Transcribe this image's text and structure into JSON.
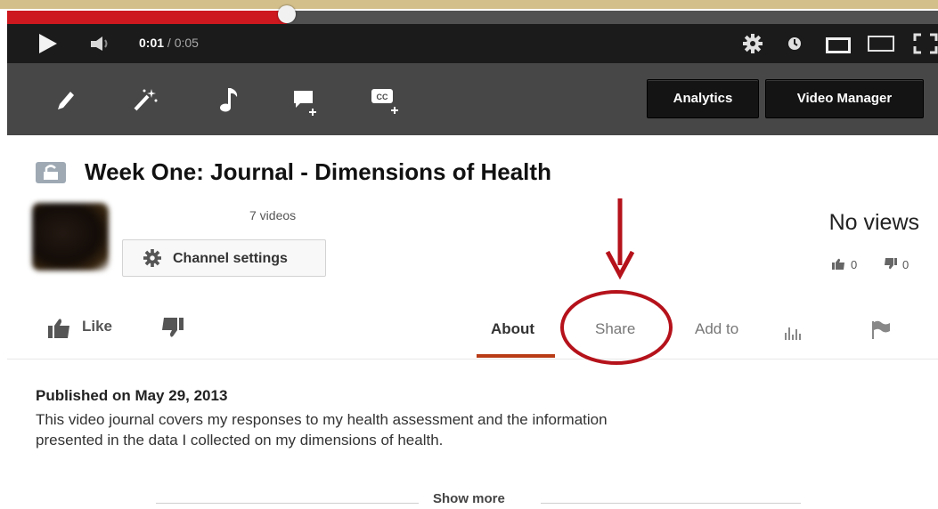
{
  "player": {
    "progress_fraction": 0.3,
    "time_current": "0:01",
    "time_separator": " / ",
    "time_total": "0:05",
    "icons": [
      "play-icon",
      "volume-icon",
      "settings-gear-icon",
      "watch-later-icon",
      "small-player-icon",
      "large-player-icon",
      "fullscreen-icon"
    ]
  },
  "toolbar": {
    "tool_icons": [
      "pencil-edit-icon",
      "magic-wand-enhance-icon",
      "music-note-audio-icon",
      "annotations-icon",
      "captions-cc-icon"
    ],
    "analytics_label": "Analytics",
    "video_manager_label": "Video Manager"
  },
  "video": {
    "title": "Week One: Journal - Dimensions of Health",
    "privacy_icon": "lock-icon"
  },
  "channel": {
    "video_count": "7 videos",
    "settings_label": "Channel settings"
  },
  "stats": {
    "views": "No views",
    "likes": "0",
    "dislikes": "0"
  },
  "actions": {
    "like_label": "Like",
    "tabs": [
      {
        "label": "About",
        "active": true
      },
      {
        "label": "Share",
        "active": false
      },
      {
        "label": "Add to",
        "active": false
      }
    ]
  },
  "description": {
    "published": "Published on May 29, 2013",
    "text": "This video journal covers my responses to my health assessment and the information presented in the data I collected on my dimensions of health.",
    "show_more_label": "Show more"
  },
  "colors": {
    "progress_red": "#cc181e",
    "annotation_red": "#b5121b",
    "tab_active_underline": "#b83b16"
  }
}
